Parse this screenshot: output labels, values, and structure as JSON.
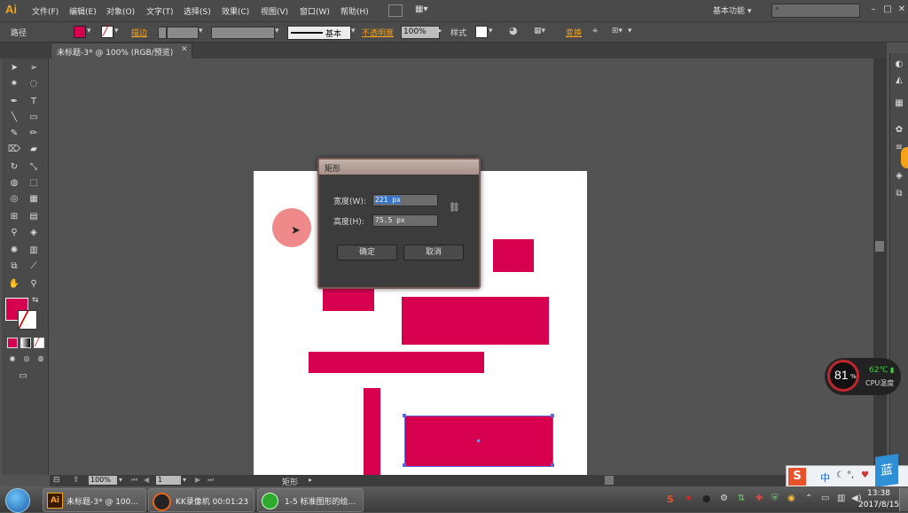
{
  "app": {
    "logo": "Ai"
  },
  "menu": [
    "文件(F)",
    "编辑(E)",
    "对象(O)",
    "文字(T)",
    "选择(S)",
    "效果(C)",
    "视图(V)",
    "窗口(W)",
    "帮助(H)"
  ],
  "workspace": "基本功能",
  "control_bar": {
    "selection_label": "路径",
    "stroke_label": "描边",
    "stroke_style": "基本",
    "opacity_label": "不透明度",
    "opacity_value": "100%",
    "style_label": "样式",
    "recolor_label": "变换",
    "fill_color": "#d6004f"
  },
  "document_tab": {
    "title": "未标题-3* @ 100% (RGB/预览)"
  },
  "dialog": {
    "title": "矩形",
    "width_label": "宽度(W):",
    "width_value": "221 px",
    "height_label": "高度(H):",
    "height_value": "75.5 px",
    "ok_label": "确定",
    "cancel_label": "取消"
  },
  "status_bar": {
    "zoom": "100%",
    "page": "1",
    "tool_name": "矩形"
  },
  "taskbar": {
    "tasks": [
      "未标题-3* @ 100...",
      "KK录像机 00:01:23",
      "1-5 标准图形的绘..."
    ],
    "clock_time": "13:38",
    "clock_date": "2017/8/15",
    "ime": "中"
  },
  "cpu_monitor": {
    "percent": "81",
    "unit": "%",
    "temp": "62℃",
    "label": "CPU温度",
    "ring_color": "#c0272d",
    "temp_color": "#3bd53b"
  },
  "colors": {
    "shape": "#d6004f",
    "circle": "#f08a8a",
    "accent": "#f7a21b"
  }
}
